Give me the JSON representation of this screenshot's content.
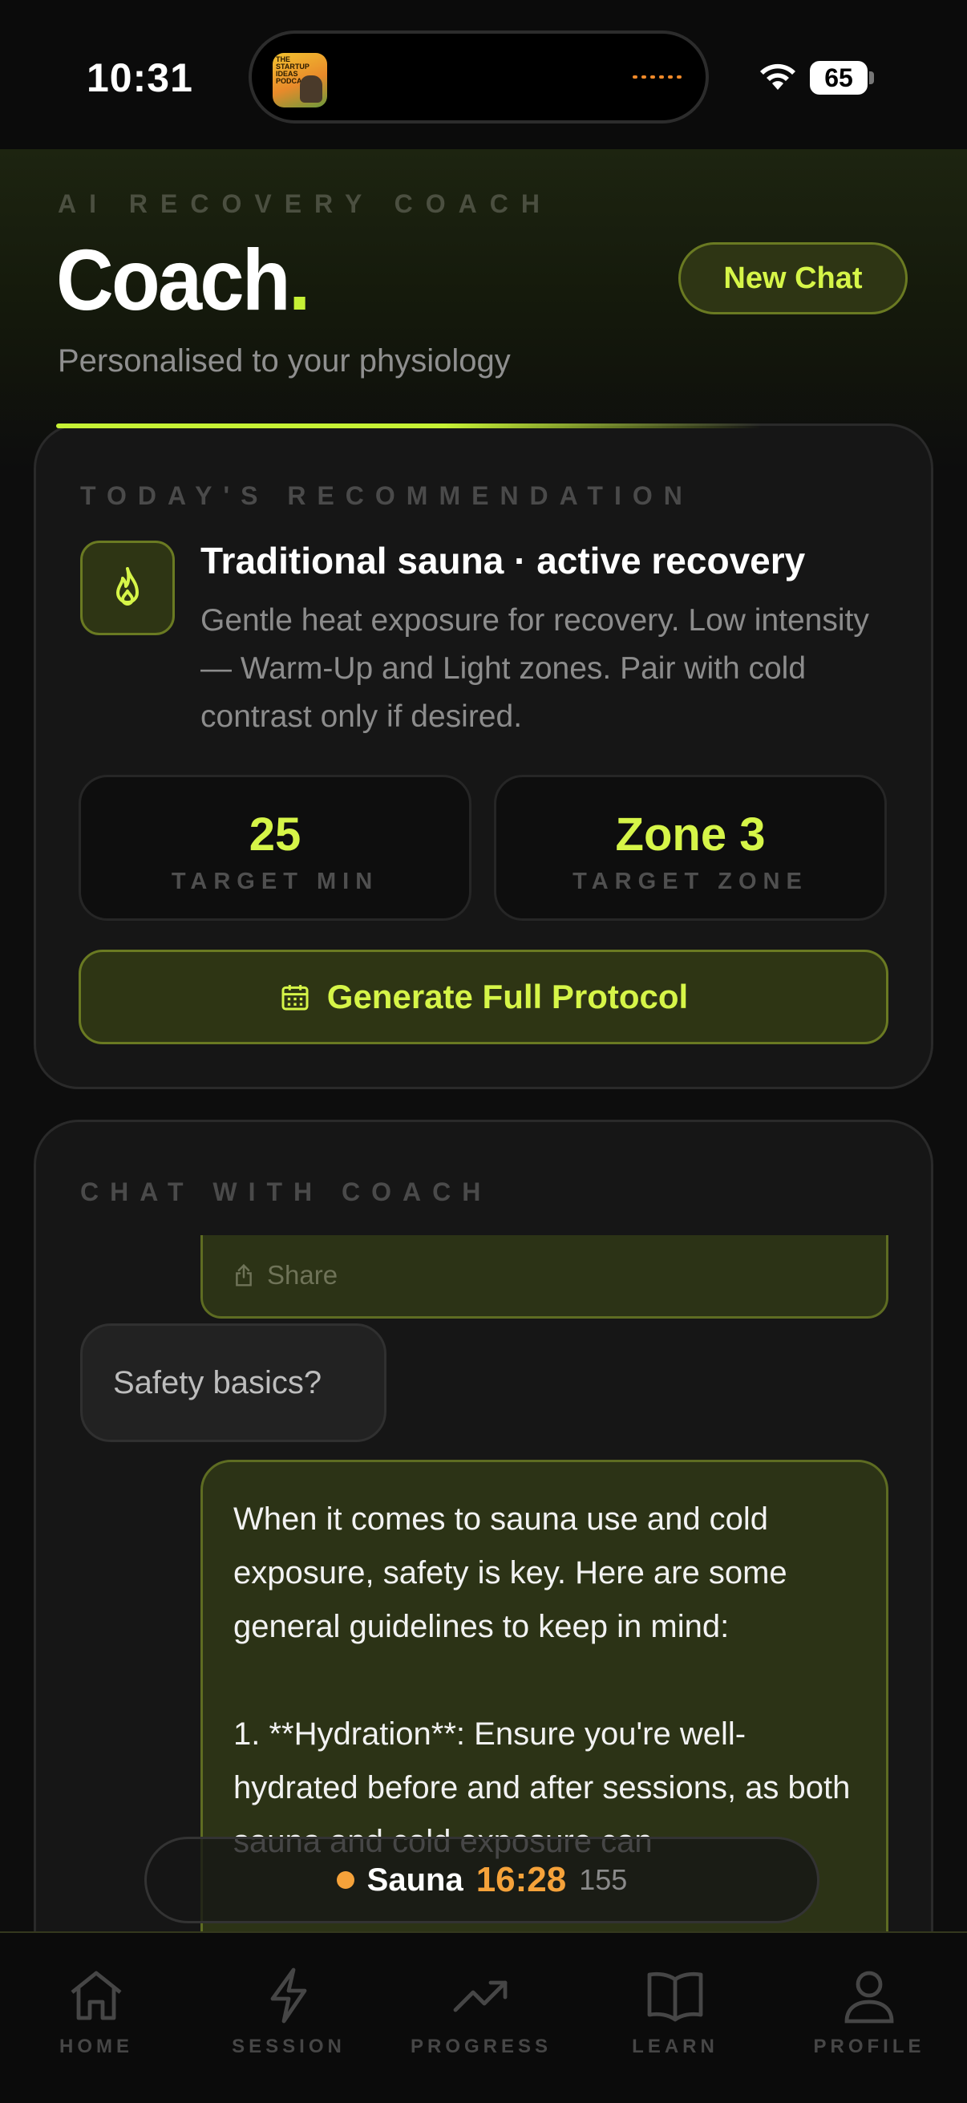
{
  "status_bar": {
    "time": "10:31",
    "battery": "65",
    "island_thumb_text": "THE STARTUP IDEAS PODCAST"
  },
  "header": {
    "eyebrow": "AI RECOVERY COACH",
    "title": "Coach",
    "title_dot": ".",
    "new_chat_label": "New Chat",
    "subtitle": "Personalised to your physiology"
  },
  "recommendation": {
    "section_label": "TODAY'S RECOMMENDATION",
    "title": "Traditional sauna · active recovery",
    "description": "Gentle heat exposure for recovery. Low intensity — Warm-Up and Light zones. Pair with cold contrast only if desired.",
    "icon": "flame-icon",
    "stats": [
      {
        "value": "25",
        "label": "TARGET MIN"
      },
      {
        "value": "Zone 3",
        "label": "TARGET ZONE"
      }
    ],
    "generate_label": "Generate Full Protocol"
  },
  "chat": {
    "section_label": "CHAT WITH COACH",
    "share_label": "Share",
    "user_message": "Safety basics?",
    "coach_message": "When it comes to sauna use and cold exposure, safety is key. Here are some general guidelines to keep in mind:\n\n1. **Hydration**: Ensure you're well-hydrated before and after sessions, as both sauna and cold exposure can"
  },
  "now_playing": {
    "name": "Sauna",
    "time": "16:28",
    "temp": "155"
  },
  "tabs": [
    {
      "label": "HOME",
      "icon": "home-icon"
    },
    {
      "label": "SESSION",
      "icon": "lightning-icon"
    },
    {
      "label": "PROGRESS",
      "icon": "trend-icon"
    },
    {
      "label": "LEARN",
      "icon": "book-icon"
    },
    {
      "label": "PROFILE",
      "icon": "person-icon"
    }
  ],
  "colors": {
    "accent": "#c6f135",
    "accent_text": "#d6f548",
    "timer": "#f5a23a",
    "background": "#0d0d0d"
  }
}
